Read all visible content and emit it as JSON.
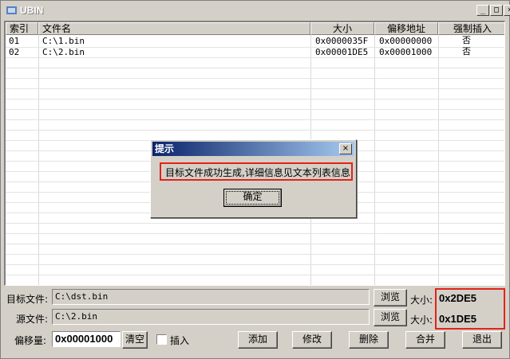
{
  "window": {
    "title": "UBIN",
    "minimize_glyph": "_",
    "maximize_glyph": "□",
    "close_glyph": "×"
  },
  "list": {
    "columns": [
      "索引",
      "文件名",
      "大小",
      "偏移地址",
      "强制插入"
    ],
    "rows": [
      {
        "index": "01",
        "name": "C:\\1.bin",
        "size": "0x0000035F",
        "offset": "0x00000000",
        "force": "否"
      },
      {
        "index": "02",
        "name": "C:\\2.bin",
        "size": "0x00001DE5",
        "offset": "0x00001000",
        "force": "否"
      }
    ]
  },
  "form": {
    "target_label": "目标文件:",
    "target_value": "C:\\dst.bin",
    "source_label": "源文件:",
    "source_value": "C:\\2.bin",
    "browse_label": "浏览",
    "size_label": "大小:",
    "target_size": "0x2DE5",
    "source_size": "0x1DE5",
    "offset_label": "偏移量:",
    "offset_value": "0x00001000",
    "clear_label": "清空",
    "insert_label": "插入"
  },
  "buttons": {
    "add": "添加",
    "modify": "修改",
    "delete": "删除",
    "merge": "合并",
    "exit": "退出"
  },
  "dialog": {
    "title": "提示",
    "message": "目标文件成功生成,详细信息见文本列表信息",
    "ok_label": "确定",
    "close_glyph": "×"
  }
}
